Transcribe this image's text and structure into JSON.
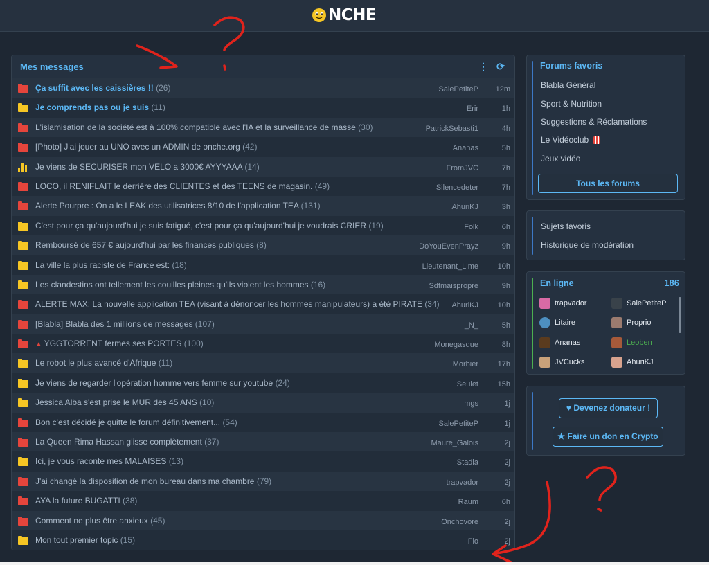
{
  "site": {
    "logo_text": "NCHE",
    "logo_icon": "smiley-face-icon"
  },
  "messages": {
    "title": "Mes messages",
    "menu_icon": "vertical-dots-icon",
    "refresh_icon": "refresh-icon",
    "rows": [
      {
        "icon": "folder-red",
        "title": "Ça suffit avec les caissières !!",
        "count": "(26)",
        "author": "SalePetiteP",
        "time": "12m",
        "style": "bold"
      },
      {
        "icon": "folder-yellow",
        "title": "Je comprends pas ou je suis",
        "count": "(11)",
        "author": "Erir",
        "time": "1h",
        "style": "bold"
      },
      {
        "icon": "folder-red",
        "title": "L'islamisation de la société est à 100% compatible avec l'IA et la surveillance de masse",
        "count": "(30)",
        "author": "PatrickSebasti1",
        "time": "4h",
        "style": "normal"
      },
      {
        "icon": "folder-red",
        "title": "[Photo] J'ai jouer au UNO avec un ADMIN de onche.org",
        "count": "(42)",
        "author": "Ananas",
        "time": "5h",
        "style": "normal"
      },
      {
        "icon": "bar-chart",
        "title": "Je viens de SECURISER mon VELO a 3000€ AYYYAAA",
        "count": "(14)",
        "author": "FromJVC",
        "time": "7h",
        "style": "normal"
      },
      {
        "icon": "folder-red",
        "title": "LOCO, il RENIFLAIT le derrière des CLIENTES et des TEENS de magasin.",
        "count": "(49)",
        "author": "Silencedeter",
        "time": "7h",
        "style": "normal"
      },
      {
        "icon": "folder-red",
        "title": "Alerte Pourpre : On a le LEAK des utilisatrices 8/10 de l'application TEA",
        "count": "(131)",
        "author": "AhuriKJ",
        "time": "3h",
        "style": "normal"
      },
      {
        "icon": "folder-yellow",
        "title": "C'est pour ça qu'aujourd'hui je suis fatigué, c'est pour ça qu'aujourd'hui je voudrais CRIER",
        "count": "(19)",
        "author": "Folk",
        "time": "6h",
        "style": "normal"
      },
      {
        "icon": "folder-yellow",
        "title": "Remboursé de 657 € aujourd'hui par les finances publiques",
        "count": "(8)",
        "author": "DoYouEvenPrayz",
        "time": "9h",
        "style": "normal"
      },
      {
        "icon": "folder-yellow",
        "title": "La ville la plus raciste de France est:",
        "count": "(18)",
        "author": "Lieutenant_Lime",
        "time": "10h",
        "style": "normal"
      },
      {
        "icon": "folder-yellow",
        "title": "Les clandestins ont tellement les couilles pleines qu'ils violent les hommes",
        "count": "(16)",
        "author": "Sdfmaispropre",
        "time": "9h",
        "style": "normal"
      },
      {
        "icon": "folder-red",
        "title": "ALERTE MAX: La nouvelle application TEA (visant à dénoncer les hommes manipulateurs) a été PIRATE",
        "count": "(34)",
        "author": "AhuriKJ",
        "time": "10h",
        "style": "normal"
      },
      {
        "icon": "folder-red",
        "title": "[Blabla] Blabla des 1 millions de messages",
        "count": "(107)",
        "author": "_N_",
        "time": "5h",
        "style": "normal"
      },
      {
        "icon": "folder-red",
        "title": "YGGTORRENT fermes ses PORTES",
        "count": "(100)",
        "author": "Monegasque",
        "time": "8h",
        "style": "normal",
        "emoji": "torrent-emoji-icon"
      },
      {
        "icon": "folder-yellow",
        "title": "Le robot le plus avancé d'Afrique",
        "count": "(11)",
        "author": "Morbier",
        "time": "17h",
        "style": "normal"
      },
      {
        "icon": "folder-yellow",
        "title": "Je viens de regarder l'opération homme vers femme sur youtube",
        "count": "(24)",
        "author": "Seulet",
        "time": "15h",
        "style": "normal"
      },
      {
        "icon": "folder-yellow",
        "title": "Jessica Alba s'est prise le MUR des 45 ANS",
        "count": "(10)",
        "author": "mgs",
        "time": "1j",
        "style": "normal"
      },
      {
        "icon": "folder-red",
        "title": "Bon c'est décidé je quitte le forum définitivement...",
        "count": "(54)",
        "author": "SalePetiteP",
        "time": "1j",
        "style": "normal"
      },
      {
        "icon": "folder-red",
        "title": "La Queen Rima Hassan glisse complètement",
        "count": "(37)",
        "author": "Maure_Galois",
        "time": "2j",
        "style": "normal"
      },
      {
        "icon": "folder-yellow",
        "title": "Ici, je vous raconte mes MALAISES",
        "count": "(13)",
        "author": "Stadia",
        "time": "2j",
        "style": "normal"
      },
      {
        "icon": "folder-red",
        "title": "J'ai changé la disposition de mon bureau dans ma chambre",
        "count": "(79)",
        "author": "trapvador",
        "time": "2j",
        "style": "normal"
      },
      {
        "icon": "folder-red",
        "title": "AYA la future BUGATTI",
        "count": "(38)",
        "author": "Raum",
        "time": "6h",
        "style": "normal"
      },
      {
        "icon": "folder-red",
        "title": "Comment ne plus être anxieux",
        "count": "(45)",
        "author": "Onchovore",
        "time": "2j",
        "style": "normal"
      },
      {
        "icon": "folder-yellow",
        "title": "Mon tout premier topic",
        "count": "(15)",
        "author": "Fio",
        "time": "2j",
        "style": "normal"
      }
    ]
  },
  "favorites": {
    "title": "Forums favoris",
    "items": [
      "Blabla Général",
      "Sport & Nutrition",
      "Suggestions & Réclamations",
      "Le Vidéoclub",
      "Jeux vidéo"
    ],
    "videoclub_icon": "popcorn-icon",
    "all_button": "Tous les forums"
  },
  "links": {
    "items": [
      "Sujets favoris",
      "Historique de modération"
    ]
  },
  "online": {
    "title": "En ligne",
    "count": "186",
    "users": [
      {
        "name": "trapvador",
        "color": "#e8e6e3"
      },
      {
        "name": "SalePetiteP",
        "color": "#e8e6e3"
      },
      {
        "name": "Litaire",
        "color": "#e8e6e3"
      },
      {
        "name": "Proprio",
        "color": "#e8e6e3"
      },
      {
        "name": "Ananas",
        "color": "#e8e6e3"
      },
      {
        "name": "Leoben",
        "color": "#4caf50"
      },
      {
        "name": "JVCucks",
        "color": "#e8e6e3"
      },
      {
        "name": "AhuriKJ",
        "color": "#e8e6e3"
      }
    ]
  },
  "donate": {
    "donor_button": "Devenez donateur !",
    "donor_icon": "heart-icon",
    "crypto_button": "Faire un don en Crypto",
    "crypto_icon": "star-icon"
  },
  "colors": {
    "accent": "#5cb8f5",
    "annotation": "#e0231c",
    "folder_red": "#e5453c",
    "folder_yellow": "#f6c624"
  }
}
